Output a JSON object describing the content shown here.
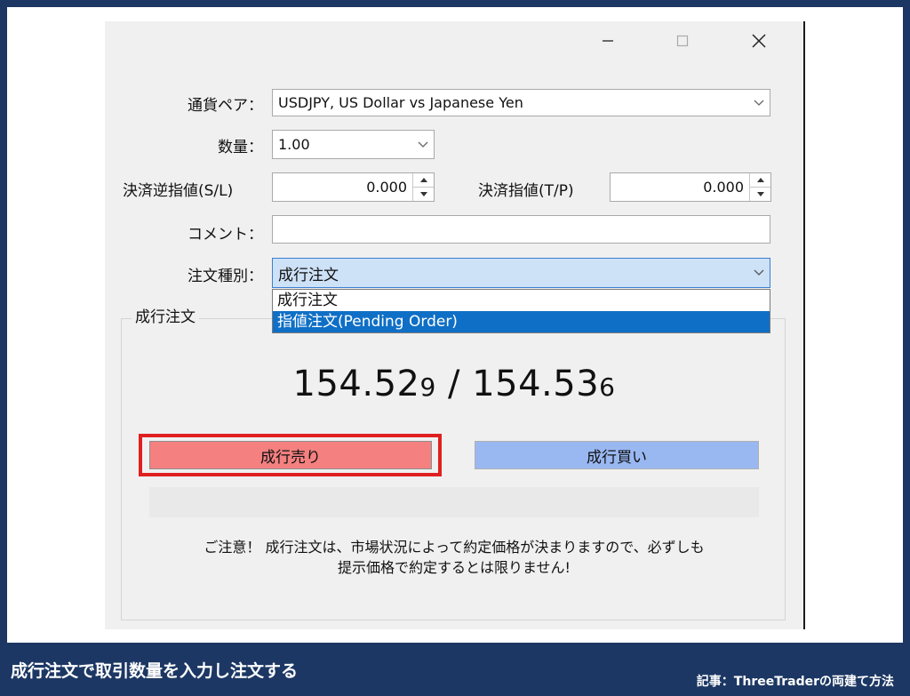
{
  "window": {
    "controls": {
      "minimize_icon": "minimize-icon",
      "maximize_icon": "maximize-icon",
      "close_icon": "close-icon"
    }
  },
  "form": {
    "symbol_label": "通貨ペア：",
    "symbol_value": "USDJPY, US Dollar vs Japanese Yen",
    "volume_label": "数量：",
    "volume_value": "1.00",
    "sl_label": "決済逆指値(S/L)",
    "sl_value": "0.000",
    "tp_label": "決済指値(T/P)",
    "tp_value": "0.000",
    "comment_label": "コメント：",
    "comment_value": "",
    "order_type_label": "注文種別：",
    "order_type_value": "成行注文",
    "order_type_options": [
      "成行注文",
      "指値注文(Pending Order)"
    ],
    "order_type_selected_option": "指値注文(Pending Order)"
  },
  "market": {
    "group_title": "成行注文",
    "bid_main": "154.52",
    "bid_small": "9",
    "separator": " / ",
    "ask_main": "154.53",
    "ask_small": "6",
    "sell_label": "成行売り",
    "buy_label": "成行買い",
    "notice_line1": "ご注意！ 成行注文は、市場状況によって約定価格が決まりますので、必ずしも",
    "notice_line2": "提示価格で約定するとは限りません!"
  },
  "colors": {
    "sell_button": "#f48080",
    "buy_button": "#99b8f2",
    "highlight_border": "#e02020",
    "selected_option": "#0f6fc6",
    "background_band": "#1c3763"
  },
  "caption": {
    "left": "成行注文で取引数量を入力し注文する",
    "right": "記事：ThreeTraderの両建て方法"
  }
}
